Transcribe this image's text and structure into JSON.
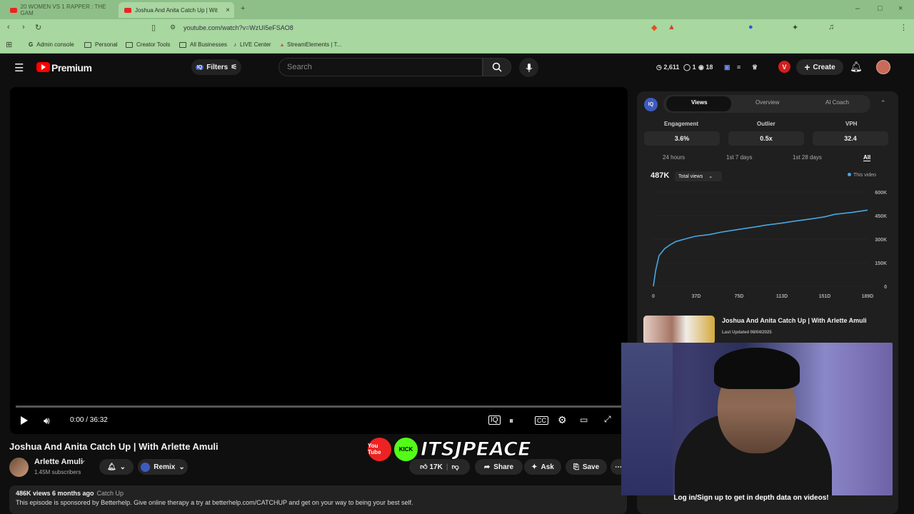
{
  "browser": {
    "tabs": [
      {
        "label": "20 WOMEN VS 1 RAPPER : THE GAM"
      },
      {
        "label": "Joshua And Anita Catch Up | Wit"
      }
    ],
    "url": "youtube.com/watch?v=WzUI5eFSAO8",
    "bookmarks": [
      "Admin console",
      "Personal",
      "Creator Tools",
      "All Businesses",
      "LIVE Center",
      "StreamElements | T..."
    ]
  },
  "header": {
    "logo_text": "Premium",
    "filters_label": "Filters",
    "search_placeholder": "Search",
    "stats": {
      "views": "2,611",
      "likes": "1",
      "watch": "18"
    },
    "v_badge": "V",
    "create_label": "Create"
  },
  "player": {
    "time": "0:00 / 36:32",
    "progress": 0
  },
  "video": {
    "title": "Joshua And Anita Catch Up | With Arlette Amuli",
    "channel": "Arlette Amuli",
    "subscribers": "1.45M subscribers",
    "remix_label": "Remix",
    "likes": "17K",
    "share_label": "Share",
    "ask_label": "Ask",
    "save_label": "Save",
    "views_line": "486K views  6 months ago",
    "tag": "Catch Up",
    "description": "This episode is sponsored by Betterhelp. Give online therapy a try at betterhelp.com/CATCHUP and get on your way to being your best self."
  },
  "overlay": {
    "brand_text": "ITSJPEACE",
    "kick_label": "KICK",
    "youtube_label": "You Tube"
  },
  "panel": {
    "logo": "IQ",
    "tabs": [
      "Views",
      "Overview",
      "AI Coach"
    ],
    "metrics": [
      {
        "label": "Engagement",
        "value": "3.6%"
      },
      {
        "label": "Outlier",
        "value": "0.5x"
      },
      {
        "label": "VPH",
        "value": "32.4"
      }
    ],
    "ranges": [
      "24 hours",
      "1st 7 days",
      "1st 28 days",
      "All"
    ],
    "total": "487K",
    "metric_select": "Total views",
    "legend": "This video",
    "card_title": "Joshua And Anita Catch Up | With Arlette Amuli",
    "card_date": "Last Updated 08/04/2025",
    "login_text": "Log in/Sign up to get in depth data on videos!"
  },
  "chart_data": {
    "type": "line",
    "x_ticks": [
      "0",
      "37D",
      "75D",
      "113D",
      "151D",
      "189D"
    ],
    "y_ticks": [
      "0",
      "150K",
      "300K",
      "450K",
      "600K"
    ],
    "ylim": [
      0,
      600000
    ],
    "xlim": [
      0,
      189
    ],
    "series": [
      {
        "name": "This video",
        "x": [
          0,
          2,
          5,
          10,
          15,
          20,
          30,
          37,
          50,
          60,
          75,
          90,
          100,
          113,
          125,
          140,
          151,
          160,
          175,
          189
        ],
        "y": [
          0,
          100000,
          195000,
          240000,
          265000,
          285000,
          305000,
          318000,
          330000,
          345000,
          362000,
          378000,
          390000,
          402000,
          415000,
          430000,
          442000,
          458000,
          470000,
          485000
        ]
      }
    ],
    "color": "#4aa6e0"
  }
}
